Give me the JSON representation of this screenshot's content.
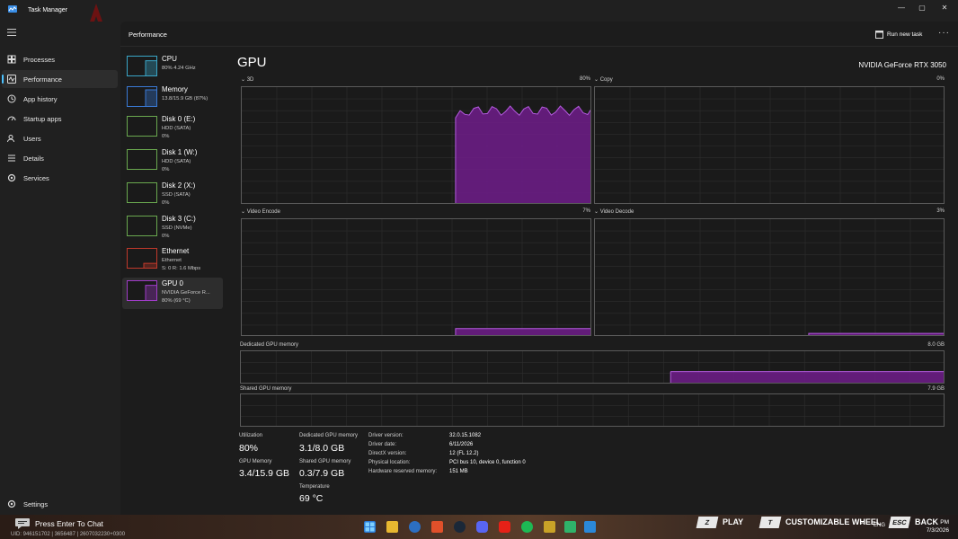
{
  "window": {
    "title": "Task Manager",
    "minimize": "—",
    "maximize": "▢",
    "close": "✕"
  },
  "nav": {
    "items": [
      {
        "label": "Processes",
        "icon": "grid-icon"
      },
      {
        "label": "Performance",
        "icon": "pulse-icon",
        "active": true
      },
      {
        "label": "App history",
        "icon": "history-icon"
      },
      {
        "label": "Startup apps",
        "icon": "speedometer-icon"
      },
      {
        "label": "Users",
        "icon": "users-icon"
      },
      {
        "label": "Details",
        "icon": "list-icon"
      },
      {
        "label": "Services",
        "icon": "cog-icon"
      }
    ],
    "settings_label": "Settings"
  },
  "header": {
    "title": "Performance",
    "run_new_task": "Run new task",
    "more": "···"
  },
  "devices": [
    {
      "name": "CPU",
      "lines": [
        "80% 4.24 GHz"
      ],
      "color": "#3aa6c8",
      "level": 0.8
    },
    {
      "name": "Memory",
      "lines": [
        "13.8/15.9 GB (87%)"
      ],
      "color": "#3a7ad6",
      "level": 0.87
    },
    {
      "name": "Disk 0 (E:)",
      "lines": [
        "HDD (SATA)",
        "0%"
      ],
      "color": "#6aa84f",
      "level": 0
    },
    {
      "name": "Disk 1 (W:)",
      "lines": [
        "HDD (SATA)",
        "0%"
      ],
      "color": "#6aa84f",
      "level": 0
    },
    {
      "name": "Disk 2 (X:)",
      "lines": [
        "SSD (SATA)",
        "0%"
      ],
      "color": "#6aa84f",
      "level": 0
    },
    {
      "name": "Disk 3 (C:)",
      "lines": [
        "SSD (NVMe)",
        "0%"
      ],
      "color": "#6aa84f",
      "level": 0
    },
    {
      "name": "Ethernet",
      "lines": [
        "Ethernet",
        "S: 0 R: 1.6 Mbps"
      ],
      "color": "#c0392b",
      "level": 0.3
    },
    {
      "name": "GPU 0",
      "lines": [
        "NVIDIA GeForce R...",
        "80% (69 °C)"
      ],
      "color": "#a03cc8",
      "level": 0.8,
      "active": true
    }
  ],
  "gpu": {
    "title": "GPU",
    "model": "NVIDIA GeForce RTX 3050",
    "graphs": {
      "g3d": {
        "label": "3D",
        "value": "80%"
      },
      "copy": {
        "label": "Copy",
        "value": "0%"
      },
      "encode": {
        "label": "Video Encode",
        "value": "7%"
      },
      "decode": {
        "label": "Video Decode",
        "value": "3%"
      },
      "dedicated": {
        "label": "Dedicated GPU memory",
        "value": "8.0 GB"
      },
      "shared": {
        "label": "Shared GPU memory",
        "value": "7.9 GB"
      }
    },
    "usage": {
      "g3d": 0.8,
      "encode": 0.07,
      "decode": 0.03,
      "dedicated": 0.39,
      "shared": 0.04
    },
    "colors": {
      "line": "#b45adf",
      "fill": "#6a1d84"
    },
    "stats": {
      "utilization_label": "Utilization",
      "utilization": "80%",
      "gpu_memory_label": "GPU Memory",
      "gpu_memory": "3.4/15.9 GB",
      "dedicated_label": "Dedicated GPU memory",
      "dedicated": "3.1/8.0 GB",
      "shared_label": "Shared GPU memory",
      "shared": "0.3/7.9 GB",
      "temperature_label": "Temperature",
      "temperature": "69 °C"
    },
    "info": [
      {
        "key": "Driver version:",
        "value": "32.0.15.1082"
      },
      {
        "key": "Driver date:",
        "value": "6/11/2026"
      },
      {
        "key": "DirectX version:",
        "value": "12 (FL 12.2)"
      },
      {
        "key": "Physical location:",
        "value": "PCI bus 10, device 0, function 0"
      },
      {
        "key": "Hardware reserved memory:",
        "value": "151 MB"
      }
    ]
  },
  "taskbar": {
    "chat": "Press Enter To Chat",
    "uid": "UID: 946151702 | 3656487 | 2607032230+0300",
    "keys": [
      {
        "key": "Z",
        "label": "PLAY"
      },
      {
        "key": "T",
        "label": "CUSTOMIZABLE WHEEL"
      },
      {
        "key": "ESC",
        "label": "BACK"
      }
    ],
    "lang": "ENG",
    "time": "PM",
    "date": "7/3/2026"
  }
}
